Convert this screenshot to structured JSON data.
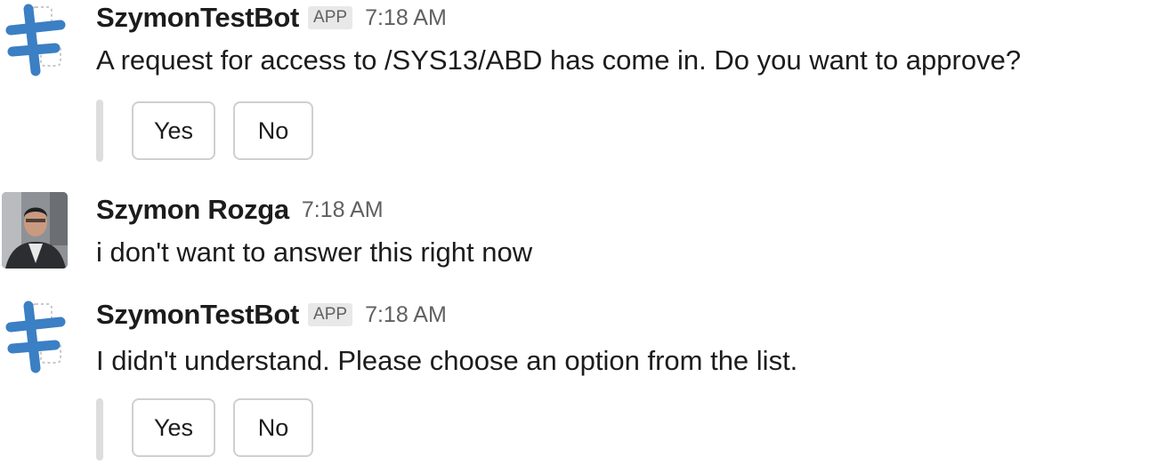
{
  "messages": [
    {
      "sender": "SzymonTestBot",
      "badge": "APP",
      "time": "7:18 AM",
      "text": "A request for access to /SYS13/ABD has come in. Do you want to approve?",
      "avatar_icon": "bot-logo-icon",
      "buttons": [
        {
          "label": "Yes"
        },
        {
          "label": "No"
        }
      ]
    },
    {
      "sender": "Szymon Rozga",
      "time": "7:18 AM",
      "text": "i don't want to answer this right now",
      "avatar_icon": "user-photo"
    },
    {
      "sender": "SzymonTestBot",
      "badge": "APP",
      "time": "7:18 AM",
      "text": "I didn't understand. Please choose an option from the list.",
      "avatar_icon": "bot-logo-icon",
      "buttons": [
        {
          "label": "Yes"
        },
        {
          "label": "No"
        }
      ]
    }
  ],
  "colors": {
    "bot_logo": "#3b7fc4",
    "text": "#1d1c1d",
    "muted": "#616061",
    "button_border": "#cfcfcf",
    "attachment_bar": "#dddddd"
  }
}
